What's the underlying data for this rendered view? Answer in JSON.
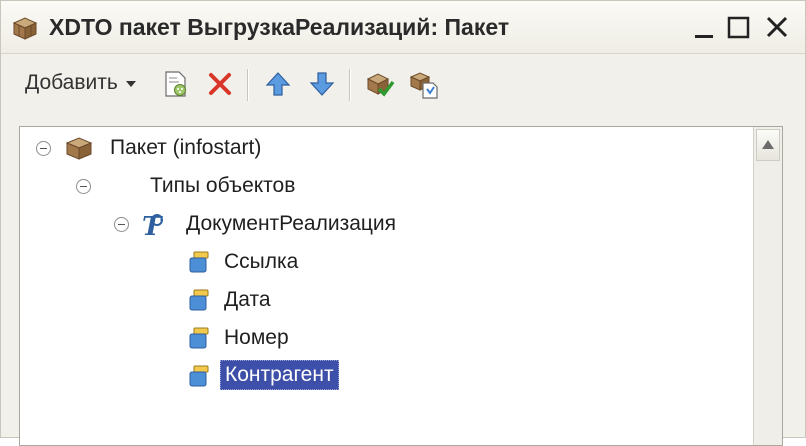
{
  "window": {
    "title": "XDTO пакет ВыгрузкаРеализаций: Пакет",
    "title_icon": "package-icon",
    "controls": [
      "minimize-icon",
      "maximize-icon",
      "close-icon"
    ]
  },
  "toolbar": {
    "add_label": "Добавить",
    "buttons": [
      "add-dropdown-button",
      "edit-icon",
      "delete-icon",
      "move-up-icon",
      "move-down-icon",
      "check-icon",
      "copy-package-icon"
    ]
  },
  "tree": {
    "root": {
      "label": "Пакет (infostart)",
      "icon": "package-icon",
      "expanded": true
    },
    "types": {
      "label": "Типы объектов",
      "expanded": true
    },
    "document": {
      "label": "ДокументРеализация",
      "icon": "object-type-icon",
      "expanded": true
    },
    "properties": [
      {
        "label": "Ссылка",
        "icon": "property-icon"
      },
      {
        "label": "Дата",
        "icon": "property-icon"
      },
      {
        "label": "Номер",
        "icon": "property-icon"
      },
      {
        "label": "Контрагент",
        "icon": "property-icon",
        "selected": true
      }
    ]
  },
  "colors": {
    "selection": "#3d4fa8",
    "window_bg": "#f2f0ea",
    "delete_red": "#d9362a",
    "arrow_blue": "#3f7fd1"
  }
}
